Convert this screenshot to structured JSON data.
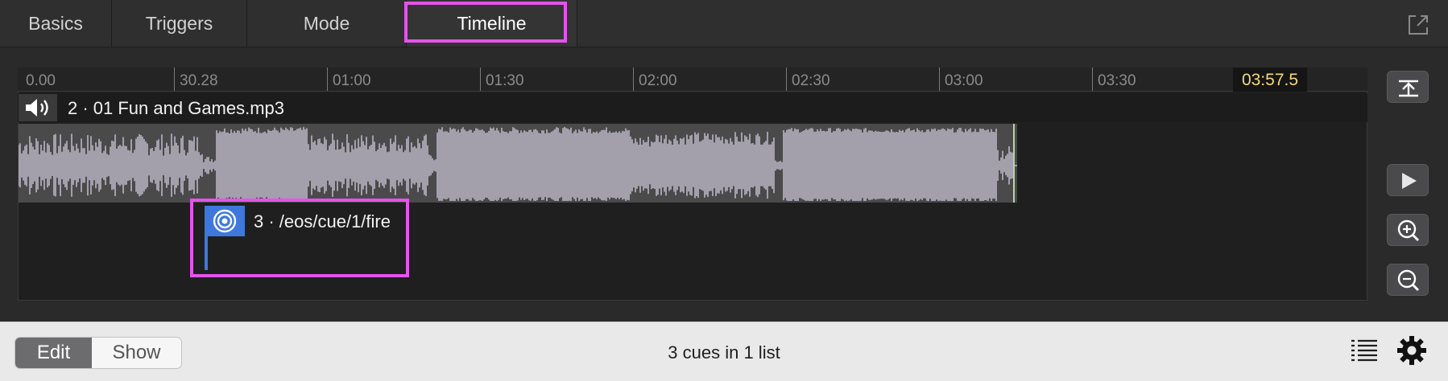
{
  "tabs": [
    {
      "label": "Basics",
      "active": false
    },
    {
      "label": "Triggers",
      "active": false
    },
    {
      "label": "Mode",
      "active": false
    },
    {
      "label": "Timeline",
      "active": true
    }
  ],
  "timeline": {
    "ruler_ticks": [
      "0.00",
      "30.28",
      "01:00",
      "01:30",
      "02:00",
      "02:30",
      "03:00",
      "03:30"
    ],
    "current_time": "03:57.5",
    "audio_track": {
      "title": "2 · 01 Fun and Games.mp3",
      "icon": "speaker-icon"
    },
    "cue": {
      "title": "3 · /eos/cue/1/fire",
      "icon": "target-icon",
      "color": "#3f78dc"
    }
  },
  "side_buttons": [
    "collapse-icon",
    "play-icon",
    "zoom-in-icon",
    "zoom-out-icon"
  ],
  "bottom_bar": {
    "mode_edit": "Edit",
    "mode_show": "Show",
    "active_mode": "Edit",
    "status": "3 cues in 1 list"
  },
  "colors": {
    "highlight": "#e354e9",
    "time_display": "#f3d97a",
    "waveform": "#a39fab"
  }
}
